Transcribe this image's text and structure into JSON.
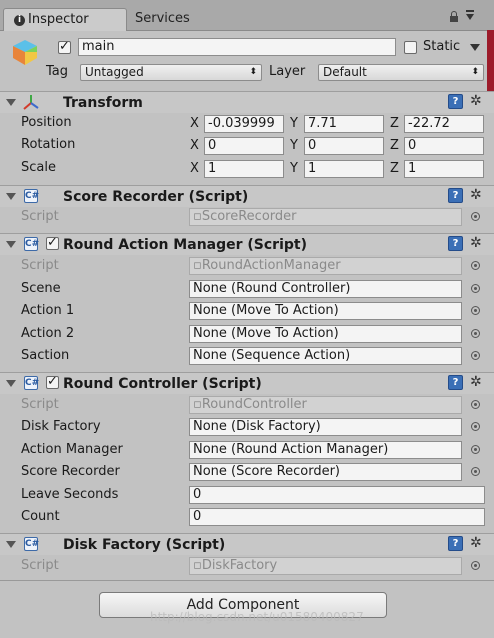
{
  "tabs": {
    "inspector": "Inspector",
    "services": "Services"
  },
  "object": {
    "name": "main",
    "static_label": "Static",
    "tag_label": "Tag",
    "tag_value": "Untagged",
    "layer_label": "Layer",
    "layer_value": "Default"
  },
  "transform": {
    "title": "Transform",
    "position_label": "Position",
    "rotation_label": "Rotation",
    "scale_label": "Scale",
    "x": "X",
    "y": "Y",
    "z": "Z",
    "position": [
      "-0.039999",
      "7.71",
      "-22.72"
    ],
    "rotation": [
      "0",
      "0",
      "0"
    ],
    "scale": [
      "1",
      "1",
      "1"
    ]
  },
  "score_recorder": {
    "title": "Score Recorder (Script)",
    "script_label": "Script",
    "script_value": "ScoreRecorder"
  },
  "round_action_manager": {
    "title": "Round Action Manager (Script)",
    "script_label": "Script",
    "script_value": "RoundActionManager",
    "scene_label": "Scene",
    "scene_value": "None (Round Controller)",
    "action1_label": "Action 1",
    "action1_value": "None (Move To Action)",
    "action2_label": "Action 2",
    "action2_value": "None (Move To Action)",
    "saction_label": "Saction",
    "saction_value": "None (Sequence Action)"
  },
  "round_controller": {
    "title": "Round Controller (Script)",
    "script_label": "Script",
    "script_value": "RoundController",
    "disk_factory_label": "Disk Factory",
    "disk_factory_value": "None (Disk Factory)",
    "action_manager_label": "Action Manager",
    "action_manager_value": "None (Round Action Manager)",
    "score_recorder_label": "Score Recorder",
    "score_recorder_value": "None (Score Recorder)",
    "leave_seconds_label": "Leave Seconds",
    "leave_seconds_value": "0",
    "count_label": "Count",
    "count_value": "0"
  },
  "disk_factory": {
    "title": "Disk Factory (Script)",
    "script_label": "Script",
    "script_value": "DiskFactory"
  },
  "add_component": "Add Component",
  "watermark": "http://blog.csdn.net/u01580400827",
  "colors": {
    "panel": "#c2c2c2",
    "help_icon": "#3b6fb6",
    "accent_strip": "#9c1b2a"
  }
}
